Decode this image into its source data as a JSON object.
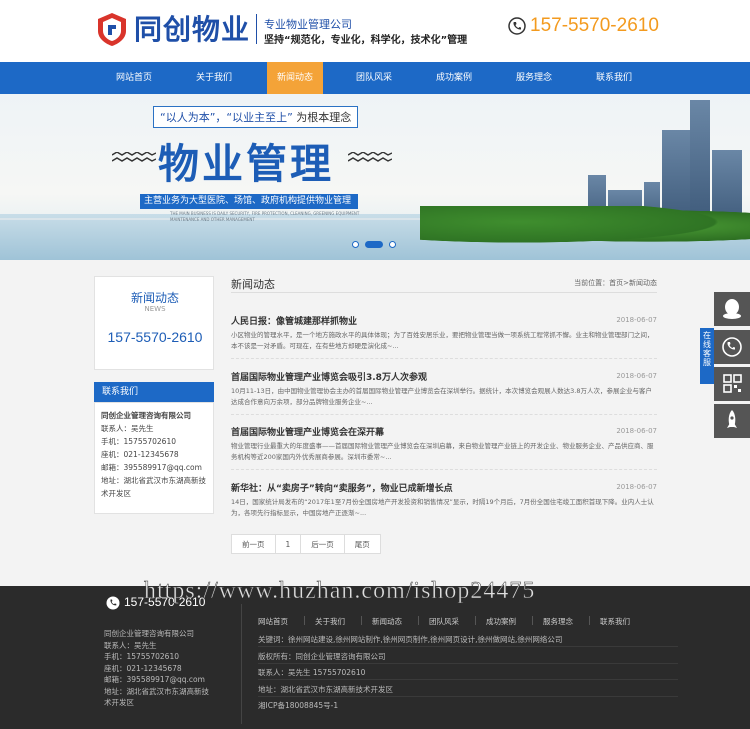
{
  "header": {
    "brand": "同创物业",
    "slogan1": "专业物业管理公司",
    "slogan2": "坚持“规范化，专业化，科学化，技术化”管理",
    "phone": "157-5570-2610"
  },
  "nav": {
    "items": [
      {
        "label": "网站首页"
      },
      {
        "label": "关于我们"
      },
      {
        "label": "新闻动态"
      },
      {
        "label": "团队风采"
      },
      {
        "label": "成功案例"
      },
      {
        "label": "服务理念"
      },
      {
        "label": "联系我们"
      }
    ],
    "active_index": 2
  },
  "banner": {
    "tagline_a": "“以人为本”，“以业主至上”",
    "tagline_b": "为根本理念",
    "title": "物业管理",
    "strip": "主营业务为大型医院、场馆、政府机构提供物业管理",
    "small": "THE MAIN BUSINESS IS DAILY SECURITY, FIRE PROTECTION, CLEANING, GREENING EQUIPMENT MAINTENANCE AND OTHER MANAGEMENT",
    "slides": 3,
    "active_slide": 1
  },
  "sidebar": {
    "title": "新闻动态",
    "subtitle": "NEWS",
    "phone": "157-5570-2610",
    "contact_head": "联系我们",
    "contact": {
      "company": "同创企业管理咨询有限公司",
      "person": "联系人：吴先生",
      "mobile": "手机：15755702610",
      "tel": "座机：021-12345678",
      "email": "邮箱：395589917@qq.com",
      "address": "地址：湖北省武汉市东湖高新技术开发区"
    }
  },
  "main": {
    "title": "新闻动态",
    "breadcrumb": "当前位置：首页>新闻动态",
    "news": [
      {
        "title": "人民日报：像管城建那样抓物业",
        "date": "2018-06-07",
        "text": "小区物业的管理水平，是一个地方施政水平的具体体现；为了百姓安居乐业，要把物业管理当做一项系统工程常抓不懈。业主和物业管理部门之间，本不该是一对矛盾。可现在，在有些地方却硬是演化成~..."
      },
      {
        "title": "首届国际物业管理产业博览会吸引3.8万人次参观",
        "date": "2018-06-07",
        "text": "10月11-13日，由中国物业管理协会主办的首届国际物业管理产业博览会在深圳举行。据统计，本次博览会观展人数达3.8万人次，参展企业与客户达成合作意向万余项，部分品牌物业服务企业~..."
      },
      {
        "title": "首届国际物业管理产业博览会在深开幕",
        "date": "2018-06-07",
        "text": "物业管理行业最重大的年度盛事——首届国际物业管理产业博览会在深圳启幕，来自物业管理产业链上的开发企业、物业服务企业、产品供应商、服务机构等近200家国内外优秀展商参展。深圳市委常~..."
      },
      {
        "title": "新华社：从“卖房子”转向“卖服务”，物业已成新增长点",
        "date": "2018-06-07",
        "text": "14日，国家统计局发布的“2017年1至7月份全国房地产开发投资和销售情况”显示，时隔19个月后，7月份全国住宅竣工面积首现下降。业内人士认为，各项先行指标显示，中国房地产正逐渐~..."
      }
    ],
    "pager": [
      "前一页",
      "1",
      "后一页",
      "尾页"
    ]
  },
  "float_bar": {
    "tab": "在线客服",
    "buttons": [
      "qq-icon",
      "phone-icon",
      "qrcode-icon",
      "rocket-icon"
    ]
  },
  "footer": {
    "phone": "157-5570-2610",
    "left": [
      "同创企业管理咨询有限公司",
      "联系人：吴先生",
      "手机：15755702610",
      "座机：021-12345678",
      "邮箱：395589917@qq.com",
      "地址：湖北省武汉市东湖高新技",
      "术开发区"
    ],
    "nav": [
      "网站首页",
      "关于我们",
      "新闻动态",
      "团队风采",
      "成功案例",
      "服务理念",
      "联系我们"
    ],
    "right": [
      "关键词：徐州网站建设,徐州网站制作,徐州网页制作,徐州网页设计,徐州做网站,徐州网络公司",
      "版权所有：同创企业管理咨询有限公司",
      "联系人：吴先生 15755702610",
      "地址：湖北省武汉市东湖高新技术开发区",
      "湘ICP备18008845号-1"
    ]
  },
  "watermark": "https://www.huzhan.com/ishop24475",
  "colors": {
    "brand_blue": "#1d69c6",
    "accent_orange": "#f4a338",
    "phone_orange": "#f39a1e",
    "footer_bg": "#2b2b2b"
  }
}
